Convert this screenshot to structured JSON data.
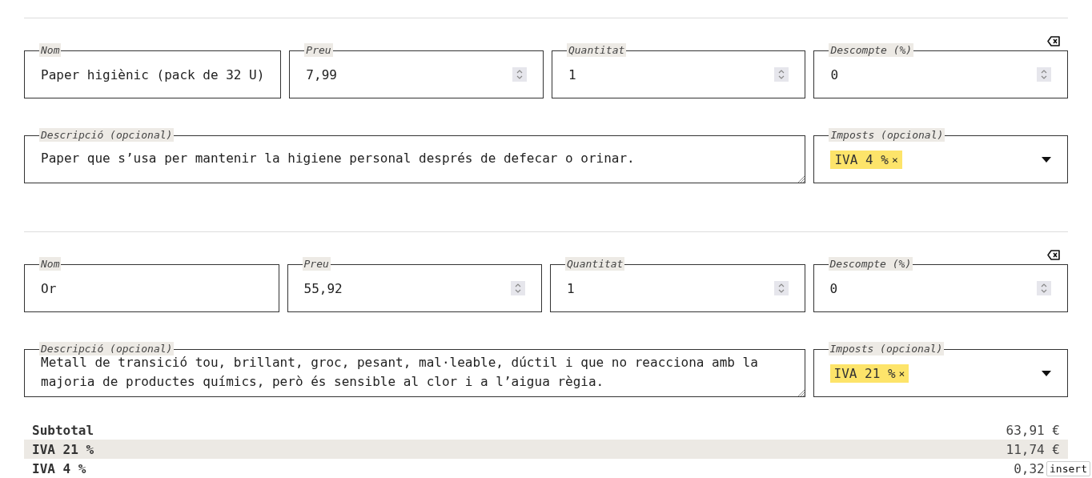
{
  "items": [
    {
      "fields": [
        {
          "kind": "text",
          "label": "Nom",
          "value": "Paper higiènic (pack de 32 U)"
        },
        {
          "kind": "number",
          "label": "Preu",
          "value": "7,99"
        },
        {
          "kind": "number",
          "label": "Quantitat",
          "value": "1"
        },
        {
          "kind": "number",
          "label": "Descompte (%)",
          "value": "0"
        }
      ],
      "description": {
        "label": "Descripció (opcional)",
        "value": "Paper que s’usa per mantenir la higiene personal després de defecar o orinar."
      },
      "taxes": {
        "label": "Imposts (opcional)",
        "tags": [
          {
            "label": "IVA 4 %",
            "remove": "×"
          }
        ]
      }
    },
    {
      "fields": [
        {
          "kind": "text",
          "label": "Nom",
          "value": "Or"
        },
        {
          "kind": "number",
          "label": "Preu",
          "value": "55,92"
        },
        {
          "kind": "number",
          "label": "Quantitat",
          "value": "1"
        },
        {
          "kind": "number",
          "label": "Descompte (%)",
          "value": "0"
        }
      ],
      "description": {
        "label": "Descripció (opcional)",
        "value": "Metall de transició tou, brillant, groc, pesant, mal·leable, dúctil i que no reacciona amb la majoria de productes químics, però és sensible al clor i a l’aigua règia."
      },
      "taxes": {
        "label": "Imposts (opcional)",
        "tags": [
          {
            "label": "IVA 21 %",
            "remove": "×"
          }
        ]
      }
    }
  ],
  "totals": [
    {
      "label": "Subtotal",
      "value": "63,91 €"
    },
    {
      "label": "IVA 21 %",
      "value": "11,74 €"
    },
    {
      "label": "IVA 4 %",
      "value": "0,32"
    }
  ],
  "insert_badge": "insert"
}
